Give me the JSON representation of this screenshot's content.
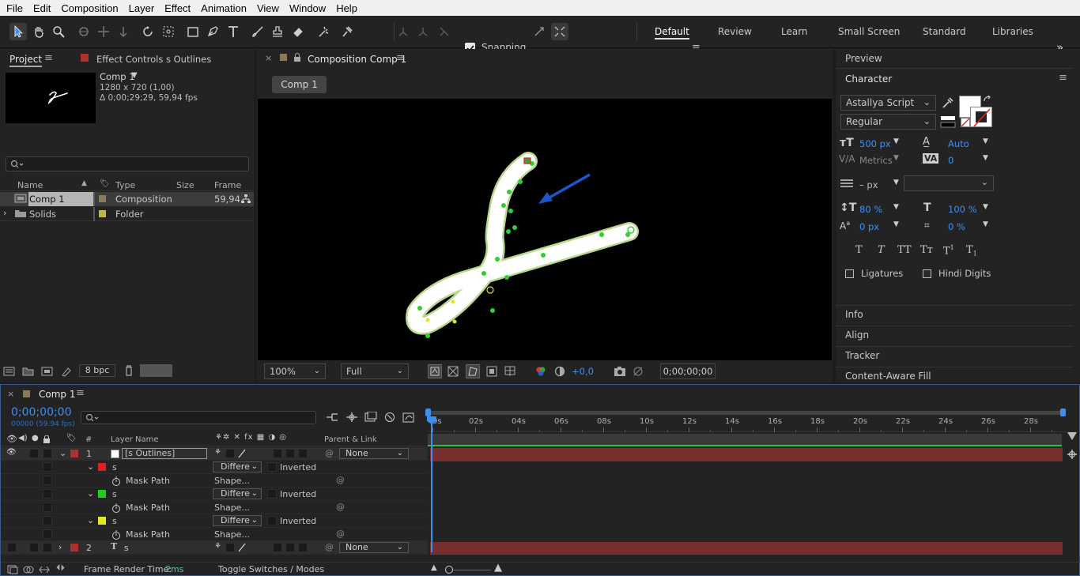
{
  "menu": [
    "File",
    "Edit",
    "Composition",
    "Layer",
    "Effect",
    "Animation",
    "View",
    "Window",
    "Help"
  ],
  "toolbar": {
    "snapping_label": "Snapping",
    "snapping_checked": true,
    "workspaces": [
      "Default",
      "Review",
      "Learn",
      "Small Screen",
      "Standard",
      "Libraries"
    ],
    "active_workspace": "Default",
    "more_icon": "»"
  },
  "project": {
    "tab_project": "Project",
    "tab_effect_controls": "Effect Controls s Outlines",
    "thumb_name": "Comp 1",
    "thumb_line1": "1280 x 720 (1,00)",
    "thumb_line2": "Δ 0;00;29;29, 59,94 fps",
    "search_placeholder": "",
    "columns": {
      "name": "Name",
      "type": "Type",
      "size": "Size",
      "frame_rate": "Frame Ra..."
    },
    "items": [
      {
        "name": "Comp 1",
        "type": "Composition",
        "frame_rate": "59,94",
        "color": "#8a7a5a",
        "selected": true
      },
      {
        "name": "Solids",
        "type": "Folder",
        "frame_rate": "",
        "color": "#c4b24a",
        "selected": false
      }
    ],
    "bpc": "8 bpc"
  },
  "composition": {
    "tab_label": "Composition Comp 1",
    "sub_tab": "Comp 1",
    "zoom": "100%",
    "resolution": "Full",
    "exposure": "+0,0",
    "timecode": "0;00;00;00"
  },
  "right_panel": {
    "preview": "Preview",
    "character": "Character",
    "font_family": "Astallya Script",
    "font_style": "Regular",
    "font_size": "500 px",
    "leading": "Auto",
    "kerning": "Metrics",
    "tracking": "0",
    "stroke_width": "– px",
    "vertical_scale": "80 %",
    "horizontal_scale": "100 %",
    "baseline_shift": "0 px",
    "tsume": "0 %",
    "ligatures": "Ligatures",
    "hindi_digits": "Hindi Digits",
    "sections": [
      "Info",
      "Align",
      "Tracker",
      "Content-Aware Fill"
    ],
    "fill_color": "#ffffff",
    "stroke_color": "#ffffff"
  },
  "timeline": {
    "tab_label": "Comp 1",
    "timecode": "0;00;00;00",
    "fps_line": "00000 (59.94 fps)",
    "columns": {
      "num": "#",
      "layer_name": "Layer Name",
      "parent": "Parent & Link"
    },
    "ruler": [
      "0s",
      "02s",
      "04s",
      "06s",
      "08s",
      "10s",
      "12s",
      "14s",
      "16s",
      "18s",
      "20s",
      "22s",
      "24s",
      "26s",
      "28s"
    ],
    "rows": [
      {
        "kind": "layer",
        "num": "1",
        "name": "[s Outlines]",
        "parent": "None",
        "color": "#b03030"
      },
      {
        "kind": "mask",
        "name": "s",
        "mode": "Differe",
        "inverted": "Inverted",
        "color": "#e02020"
      },
      {
        "kind": "path",
        "name": "Mask Path",
        "value": "Shape..."
      },
      {
        "kind": "mask",
        "name": "s",
        "mode": "Differe",
        "inverted": "Inverted",
        "color": "#22cc22"
      },
      {
        "kind": "path",
        "name": "Mask Path",
        "value": "Shape..."
      },
      {
        "kind": "mask",
        "name": "s",
        "mode": "Differe",
        "inverted": "Inverted",
        "color": "#e6e620"
      },
      {
        "kind": "path",
        "name": "Mask Path",
        "value": "Shape..."
      },
      {
        "kind": "layer2",
        "num": "2",
        "name": "s",
        "parent": "None",
        "color": "#b03030"
      }
    ],
    "footer_render_label": "Frame Render Time:",
    "footer_render_value": "2ms",
    "footer_toggle": "Toggle Switches / Modes"
  }
}
